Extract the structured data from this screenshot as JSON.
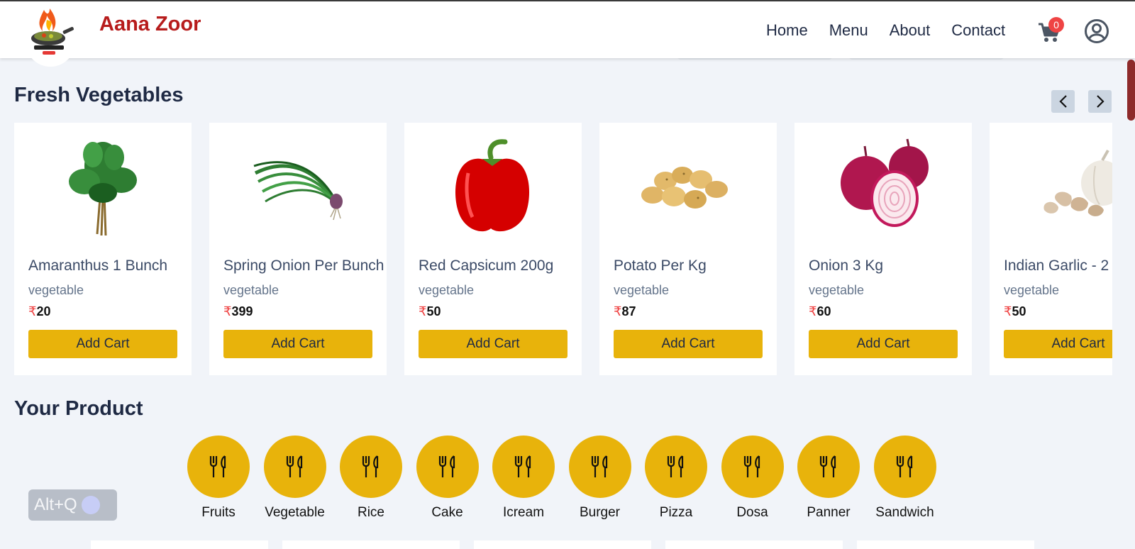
{
  "header": {
    "brand": "Aana Zoor",
    "nav": [
      "Home",
      "Menu",
      "About",
      "Contact"
    ],
    "cart_count": "0"
  },
  "fresh": {
    "title": "Fresh Vegetables",
    "products": [
      {
        "name": "Amaranthus 1 Bunch",
        "category": "vegetable",
        "currency": "₹",
        "price": "20",
        "button": "Add Cart",
        "image": "amaranthus"
      },
      {
        "name": "Spring Onion Per Bunch",
        "category": "vegetable",
        "currency": "₹",
        "price": "399",
        "button": "Add Cart",
        "image": "spring-onion"
      },
      {
        "name": "Red Capsicum 200g",
        "category": "vegetable",
        "currency": "₹",
        "price": "50",
        "button": "Add Cart",
        "image": "red-capsicum"
      },
      {
        "name": "Potato Per Kg",
        "category": "vegetable",
        "currency": "₹",
        "price": "87",
        "button": "Add Cart",
        "image": "potato"
      },
      {
        "name": "Onion 3 Kg",
        "category": "vegetable",
        "currency": "₹",
        "price": "60",
        "button": "Add Cart",
        "image": "onion"
      },
      {
        "name": "Indian Garlic - 2",
        "category": "vegetable",
        "currency": "₹",
        "price": "50",
        "button": "Add Cart",
        "image": "garlic"
      }
    ]
  },
  "your_product": {
    "title": "Your Product",
    "categories": [
      "Fruits",
      "Vegetable",
      "Rice",
      "Cake",
      "Icream",
      "Burger",
      "Pizza",
      "Dosa",
      "Panner",
      "Sandwich"
    ]
  },
  "shortcut": {
    "label": "Alt+Q"
  },
  "colors": {
    "accent": "#e8b30b",
    "brand": "#b71c1c",
    "badge": "#ef4444",
    "background": "#f1f4f9"
  }
}
